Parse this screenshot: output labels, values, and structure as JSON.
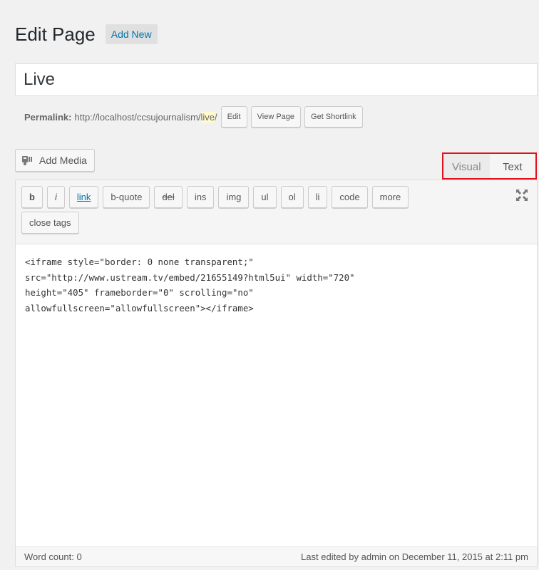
{
  "header": {
    "title": "Edit Page",
    "add_new_label": "Add New"
  },
  "post_title": {
    "value": "Live"
  },
  "permalink": {
    "label": "Permalink:",
    "url_prefix": "http://localhost/ccsujournalism/",
    "slug": "live",
    "url_suffix": "/",
    "edit_label": "Edit",
    "view_label": "View Page",
    "shortlink_label": "Get Shortlink"
  },
  "media": {
    "add_media_label": "Add Media"
  },
  "editor_tabs": {
    "visual_label": "Visual",
    "text_label": "Text",
    "active": "Text",
    "highlight_color": "#e0131d"
  },
  "quicktags": {
    "b": "b",
    "i": "i",
    "link": "link",
    "b_quote": "b-quote",
    "del": "del",
    "ins": "ins",
    "img": "img",
    "ul": "ul",
    "ol": "ol",
    "li": "li",
    "code": "code",
    "more": "more",
    "close_tags": "close tags"
  },
  "editor": {
    "content": "<iframe style=\"border: 0 none transparent;\"\nsrc=\"http://www.ustream.tv/embed/21655149?html5ui\" width=\"720\"\nheight=\"405\" frameborder=\"0\" scrolling=\"no\"\nallowfullscreen=\"allowfullscreen\"></iframe>"
  },
  "status": {
    "word_count": "Word count: 0",
    "last_edited": "Last edited by admin on December 11, 2015 at 2:11 pm"
  },
  "colors": {
    "link": "#0073aa",
    "background": "#f1f1f1"
  }
}
